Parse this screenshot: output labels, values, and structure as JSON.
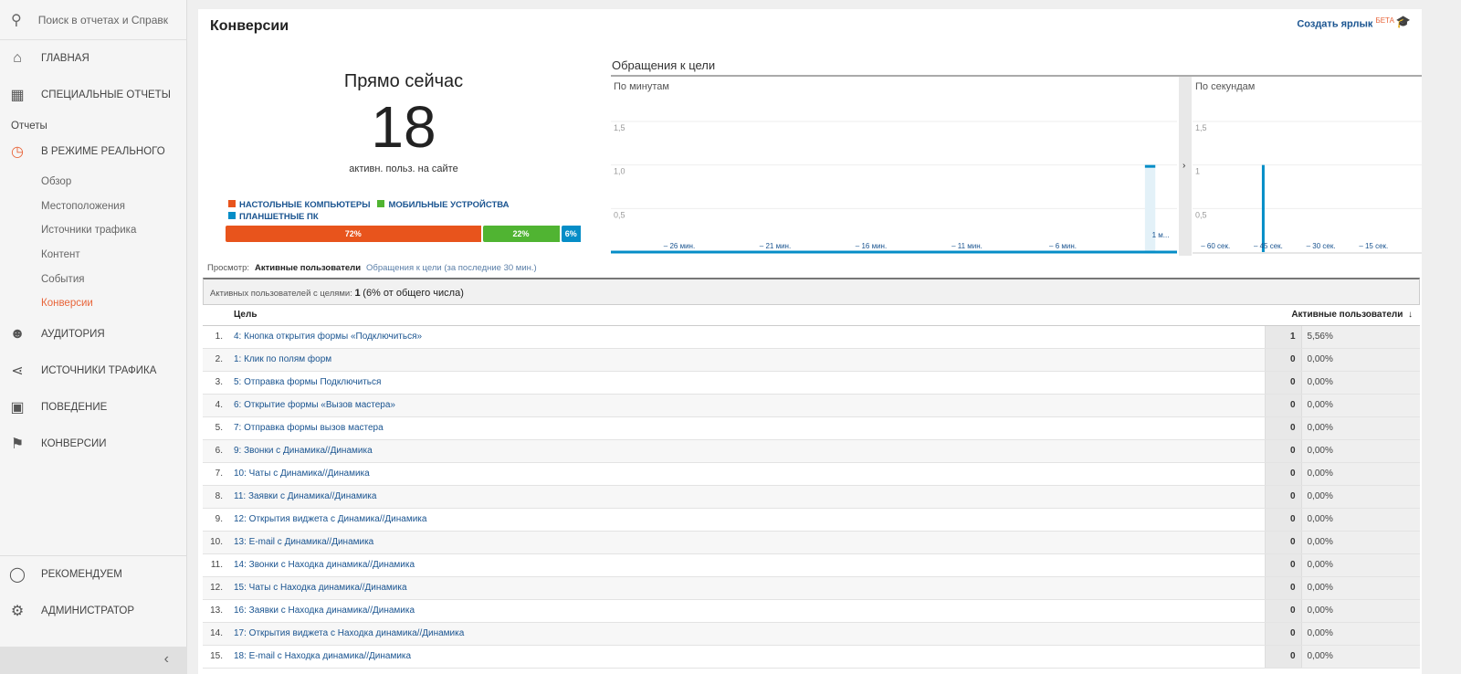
{
  "sidebar": {
    "search_placeholder": "Поиск в отчетах и Справк",
    "home": "ГЛАВНАЯ",
    "custom": "СПЕЦИАЛЬНЫЕ ОТЧЕТЫ",
    "reports": "Отчеты",
    "realtime": "В РЕЖИМЕ РЕАЛЬНОГО",
    "sub": [
      "Обзор",
      "Местоположения",
      "Источники трафика",
      "Контент",
      "События",
      "Конверсии"
    ],
    "audience": "АУДИТОРИЯ",
    "acquisition": "ИСТОЧНИКИ ТРАФИКА",
    "behavior": "ПОВЕДЕНИЕ",
    "conversions": "КОНВЕРСИИ",
    "discover": "РЕКОМЕНДУЕМ",
    "admin": "АДМИНИСТРАТОР"
  },
  "header": {
    "title": "Конверсии",
    "shortcut": "Создать ярлык",
    "beta": "БЕТА"
  },
  "now": {
    "title": "Прямо сейчас",
    "count": "18",
    "subtitle": "активн. польз. на сайте"
  },
  "devices": {
    "legend": [
      "НАСТОЛЬНЫЕ КОМПЬЮТЕРЫ",
      "МОБИЛЬНЫЕ УСТРОЙСТВА",
      "ПЛАНШЕТНЫЕ ПК"
    ],
    "labels": [
      "72%",
      "22%",
      "6%"
    ],
    "values": [
      72,
      22,
      6
    ],
    "colors": [
      "#e8541c",
      "#50b432",
      "#058dc7"
    ]
  },
  "chart_data": [
    {
      "type": "bar",
      "title": "Обращения к цели",
      "subtitle": "По минутам",
      "yticks": [
        "1,5",
        "1,0",
        "0,5"
      ],
      "ylim": [
        0,
        1.5
      ],
      "xticks": [
        "– 26 мин.",
        "– 21 мин.",
        "– 16 мин.",
        "– 11 мин.",
        "– 6 мин.",
        "1 м..."
      ],
      "values": [
        0,
        0,
        0,
        0,
        0,
        0,
        0,
        0,
        0,
        0,
        0,
        0,
        0,
        0,
        0,
        0,
        0,
        0,
        0,
        0,
        0,
        0,
        0,
        0,
        0,
        0,
        0,
        0,
        1,
        0
      ]
    },
    {
      "type": "bar",
      "subtitle": "По секундам",
      "yticks": [
        "1,5",
        "1",
        "0,5"
      ],
      "ylim": [
        0,
        1.5
      ],
      "xticks": [
        "– 60 сек.",
        "– 45 сек.",
        "– 30 сек.",
        "– 15 сек."
      ],
      "points": [
        {
          "x": -45,
          "y": 1
        }
      ]
    }
  ],
  "view": {
    "label": "Просмотр:",
    "active": "Активные пользователи",
    "other": "Обращения к цели (за последние 30 мин.)"
  },
  "summary": {
    "label": "Активных пользователей с целями:",
    "count": "1",
    "pct": "(6% от общего числа)"
  },
  "table": {
    "col_goal": "Цель",
    "col_users": "Активные пользователи",
    "rows": [
      [
        "1.",
        "4: Кнопка открытия формы «Подключиться»",
        "1",
        "5,56%"
      ],
      [
        "2.",
        "1: Клик по полям форм",
        "0",
        "0,00%"
      ],
      [
        "3.",
        "5: Отправка формы Подключиться",
        "0",
        "0,00%"
      ],
      [
        "4.",
        "6: Открытие формы «Вызов мастера»",
        "0",
        "0,00%"
      ],
      [
        "5.",
        "7: Отправка формы вызов мастера",
        "0",
        "0,00%"
      ],
      [
        "6.",
        "9: Звонки с Динамика//Динамика",
        "0",
        "0,00%"
      ],
      [
        "7.",
        "10: Чаты с Динамика//Динамика",
        "0",
        "0,00%"
      ],
      [
        "8.",
        "11: Заявки с Динамика//Динамика",
        "0",
        "0,00%"
      ],
      [
        "9.",
        "12: Открытия виджета с Динамика//Динамика",
        "0",
        "0,00%"
      ],
      [
        "10.",
        "13: E-mail с Динамика//Динамика",
        "0",
        "0,00%"
      ],
      [
        "11.",
        "14: Звонки с Находка динамика//Динамика",
        "0",
        "0,00%"
      ],
      [
        "12.",
        "15: Чаты с Находка динамика//Динамика",
        "0",
        "0,00%"
      ],
      [
        "13.",
        "16: Заявки с Находка динамика//Динамика",
        "0",
        "0,00%"
      ],
      [
        "14.",
        "17: Открытия виджета с Находка динамика//Динамика",
        "0",
        "0,00%"
      ],
      [
        "15.",
        "18: E-mail с Находка динамика//Динамика",
        "0",
        "0,00%"
      ]
    ]
  }
}
